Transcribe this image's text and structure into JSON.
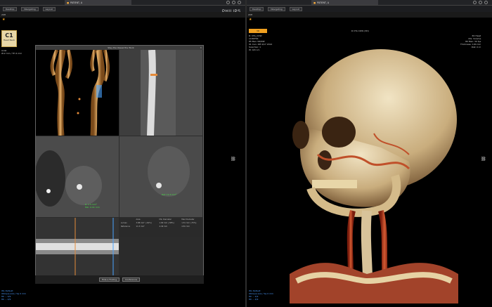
{
  "window": {
    "left_patient_tab": "PATIENT, A",
    "right_patient_tab": "PATIENT, A",
    "brand": "PHILIPS"
  },
  "toolbar": {
    "left": [
      "Desktop",
      "Navigating",
      "Layout"
    ],
    "right": [
      "Desktop",
      "Navigating",
      "Layout"
    ]
  },
  "left_viewport": {
    "sub_label": "20H",
    "badge_top": "C1",
    "badge_bottom": "Head Neck",
    "info_line1": "Axial",
    "info_line2": "W:2 mm / TH 4 mm",
    "bottom_line1": "WL Default",
    "bottom_line2": "Oblique axis / Sq 0 mm",
    "bottom_line3": "80 ... 4/9",
    "bottom_line4": "80 ... 4/9",
    "dialog_title": "Stay the Vessel the Work",
    "measure_table": {
      "headers": [
        "",
        "Area",
        "Min Diameter",
        "Max Diameter"
      ],
      "rows": [
        [
          "Lumen",
          "3.88 mm² (-62%)",
          "1.90 mm (-58%)",
          "1.51 mm (-75%)"
        ],
        [
          "Reference",
          "11.5 mm²",
          "4.49 mm",
          "4.81 mm"
        ]
      ]
    },
    "dialog_buttons": [
      "Hide a Finding",
      "Conference"
    ]
  },
  "right_viewport": {
    "sub_label": "20H",
    "orange_tag": "3D",
    "tag_top": "R CTA COW (3D)",
    "info_left": [
      "R: CTA_COW",
      "1189756",
      "85 Max 3D/MIP",
      "91 Can: 0M 4/17 2012",
      "Scan/Ver: 1",
      "W: 0/0 nm"
    ],
    "info_right": [
      "3D Head",
      "Cfe: Volume",
      "80 Max: 30 fps",
      "Thickness: 100 mm",
      "Dist: 0 m"
    ],
    "bottom_line1": "WL Default",
    "bottom_line2": "Oblique axis / Sq 0 mm",
    "bottom_line3": "80 ... 4/9",
    "bottom_line4": "80 ... 4/9"
  }
}
